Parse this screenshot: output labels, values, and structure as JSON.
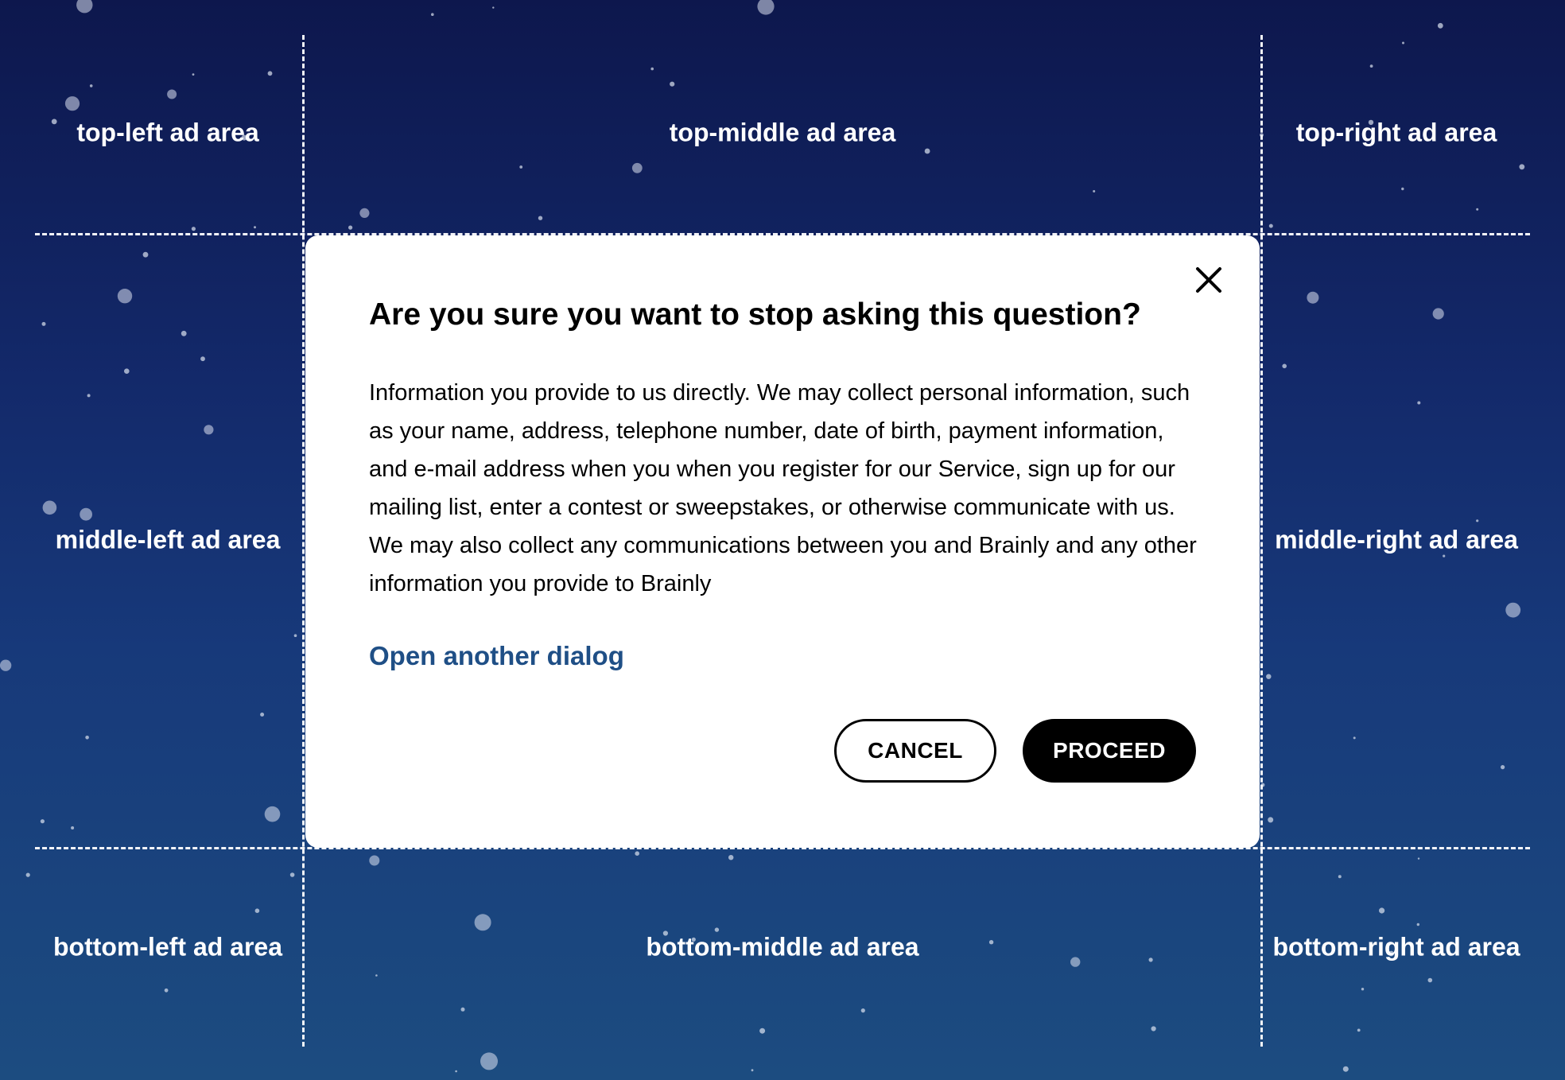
{
  "ad_areas": {
    "top_left": "top-left ad area",
    "top_middle": "top-middle ad area",
    "top_right": "top-right ad area",
    "middle_left": "middle-left ad area",
    "middle_right": "middle-right ad area",
    "bottom_left": "bottom-left ad area",
    "bottom_middle": "bottom-middle ad area",
    "bottom_right": "bottom-right ad area"
  },
  "dialog": {
    "title": "Are you sure you want to stop asking this question?",
    "body": "Information you provide to us directly. We may collect personal information, such as your name, address, telephone number, date of birth, payment information, and e-mail address when you when you register for our Service, sign up for our mailing list, enter a contest or sweepstakes, or otherwise communicate with us. We may also collect any communications between you and Brainly and any other information you provide to Brainly",
    "link_label": "Open another dialog",
    "close_icon": "close-icon",
    "cancel_label": "CANCEL",
    "proceed_label": "PROCEED"
  },
  "colors": {
    "background_top": "#0d174d",
    "background_bottom": "#1c4c80",
    "link": "#1f4f86",
    "primary_button": "#000000",
    "dialog_background": "#ffffff"
  }
}
